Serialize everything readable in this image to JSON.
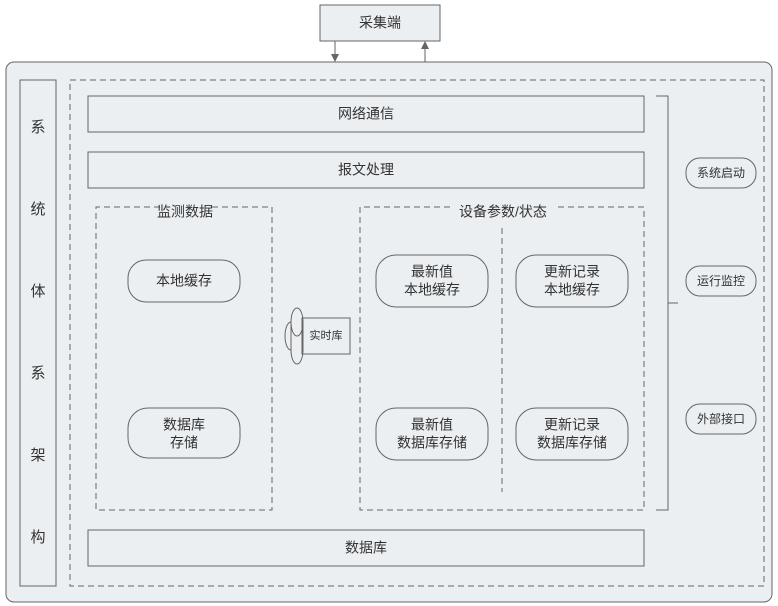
{
  "top_box": "采集端",
  "left_label_chars": [
    "系",
    "统",
    "体",
    "系",
    "架",
    "构"
  ],
  "network_box": "网络通信",
  "message_box": "报文处理",
  "monitor_group": "监测数据",
  "monitor_left_top": "本地缓存",
  "monitor_left_bottom_l1": "数据库",
  "monitor_left_bottom_l2": "存储",
  "cylinder_label": "实时库",
  "device_group": "设备参数/状态",
  "device_tl_l1": "最新值",
  "device_tl_l2": "本地缓存",
  "device_tr_l1": "更新记录",
  "device_tr_l2": "本地缓存",
  "device_bl_l1": "最新值",
  "device_bl_l2": "数据库存储",
  "device_br_l1": "更新记录",
  "device_br_l2": "数据库存储",
  "bottom_box": "数据库",
  "right1": "系统启动",
  "right2": "运行监控",
  "right3": "外部接口"
}
